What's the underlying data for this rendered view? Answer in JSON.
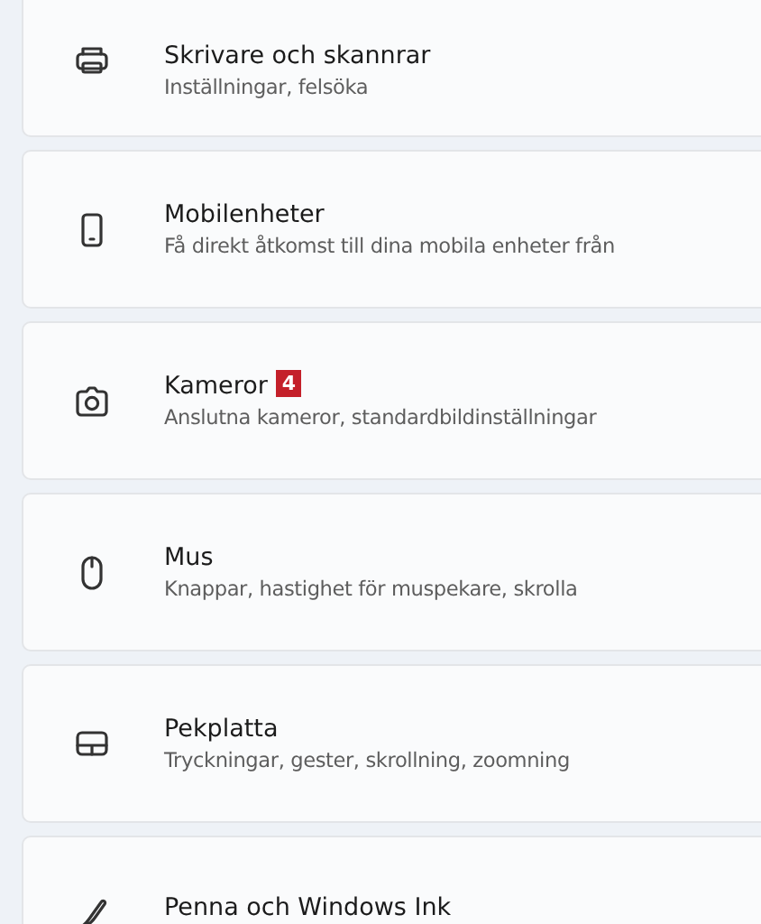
{
  "settings_items": [
    {
      "title": "Skrivare och skannrar",
      "subtitle": "Inställningar, felsöka"
    },
    {
      "title": "Mobilenheter",
      "subtitle": "Få direkt åtkomst till dina mobila enheter från"
    },
    {
      "title": "Kameror",
      "badge": "4",
      "subtitle": "Anslutna kameror, standardbildinställningar"
    },
    {
      "title": "Mus",
      "subtitle": "Knappar, hastighet för muspekare, skrolla"
    },
    {
      "title": "Pekplatta",
      "subtitle": "Tryckningar, gester, skrollning, zoomning"
    },
    {
      "title": "Penna och Windows Ink"
    }
  ]
}
